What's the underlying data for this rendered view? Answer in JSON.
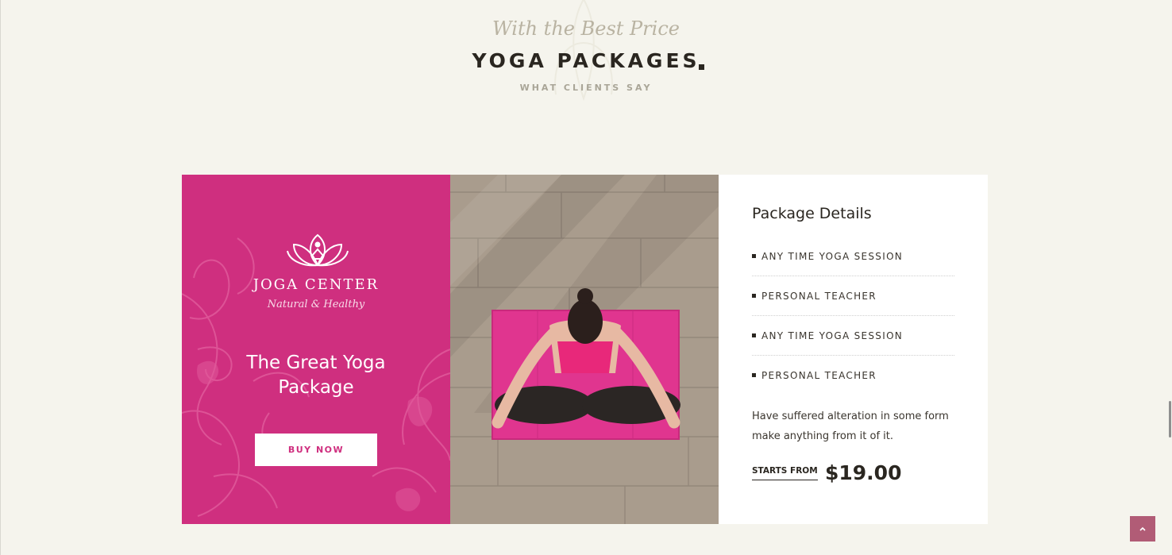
{
  "header": {
    "script_title": "With the Best Price",
    "main_title": "YOGA PACKAGES",
    "sub_title": "WHAT CLIENTS SAY"
  },
  "promo": {
    "logo_title": "JOGA CENTER",
    "logo_subtitle": "Natural & Healthy",
    "title": "The Great Yoga Package",
    "button_label": "BUY NOW",
    "background_color": "#cf2f7f"
  },
  "details": {
    "title": "Package Details",
    "features": [
      "ANY TIME YOGA SESSION",
      "PERSONAL TEACHER",
      "ANY TIME YOGA SESSION",
      "PERSONAL TEACHER"
    ],
    "description": "Have suffered alteration in some form make anything from it of it.",
    "starts_from_label": "STARTS FROM",
    "price": "$19.00"
  },
  "icons": {
    "back_to_top": "chevron-up-icon",
    "logo": "lotus-icon"
  }
}
